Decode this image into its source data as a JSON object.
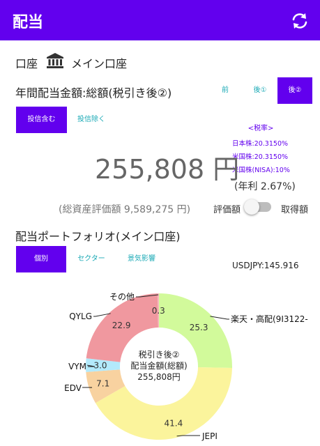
{
  "app": {
    "title": "配当"
  },
  "account": {
    "label": "口座",
    "name": "メイン口座"
  },
  "dividend": {
    "section_title": "年間配当金額:総額(税引き後②)",
    "tax_tabs": [
      {
        "label": "前",
        "selected": false
      },
      {
        "label": "後①",
        "selected": false
      },
      {
        "label": "後②",
        "selected": true
      }
    ],
    "filter_tabs": [
      {
        "label": "投信含む",
        "selected": true
      },
      {
        "label": "投信除く",
        "selected": false
      }
    ],
    "amount": "255,808 円",
    "yield_text": "(年利 2.67%)",
    "total_assets_text": "(総資産評価額 9,589,275 円)",
    "tax_rates": {
      "title": "<税率>",
      "lines": [
        "日本株:20.3150%",
        "米国株:20.3150%",
        "米国株(NISA):10%"
      ]
    },
    "toggle": {
      "left_label": "評価額",
      "right_label": "取得額",
      "on": false
    }
  },
  "portfolio": {
    "section_title": "配当ポートフォリオ(メイン口座)",
    "tabs": [
      {
        "label": "個別",
        "selected": true
      },
      {
        "label": "セクター",
        "selected": false
      },
      {
        "label": "景気影響",
        "selected": false
      }
    ],
    "fx_rate": "USDJPY:145.916"
  },
  "colors": {
    "accent": "#6200ee",
    "teal": "#19a9b5",
    "green": "#d2fa9b",
    "yellow": "#fbf49c",
    "orange": "#f8d2a0",
    "blue": "#b3eafc",
    "red": "#f0989f",
    "pink": "#f6b8bd"
  },
  "chart_data": {
    "type": "pie",
    "style": "donut",
    "center_lines": [
      "税引き後②",
      "配当金額(総額)",
      "255,808円"
    ],
    "slices": [
      {
        "name": "楽天・高配(9I3122-",
        "value": 25.3,
        "label": "25.3",
        "color": "#d2fa9b"
      },
      {
        "name": "JEPI",
        "value": 41.4,
        "label": "41.4",
        "color": "#fbf49c"
      },
      {
        "name": "EDV",
        "value": 7.1,
        "label": "7.1",
        "color": "#f8d2a0"
      },
      {
        "name": "VYM",
        "value": 3.0,
        "label": "3.0",
        "color": "#b3eafc"
      },
      {
        "name": "QYLG",
        "value": 22.9,
        "label": "22.9",
        "color": "#f0989f"
      },
      {
        "name": "その他",
        "value": 0.3,
        "label": "0.3",
        "color": "#f6b8bd"
      }
    ]
  }
}
